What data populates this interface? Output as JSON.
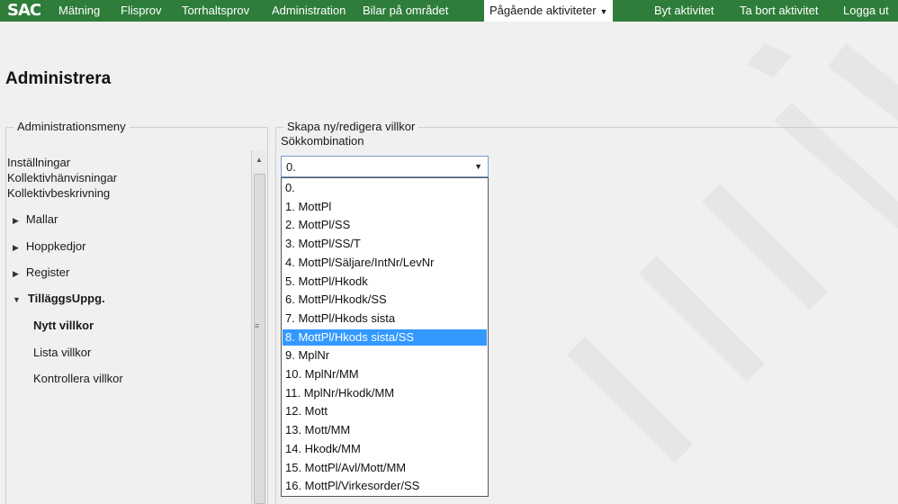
{
  "nav": {
    "logo": "SAC",
    "items": [
      "Mätning",
      "Flisprov",
      "Torrhaltsprov",
      "Administration",
      "Bilar på området"
    ],
    "active": "Pågående aktiviteter",
    "right_items": [
      "Byt aktivitet",
      "Ta bort aktivitet",
      "Logga ut"
    ]
  },
  "page": {
    "title": "Administrera"
  },
  "menu": {
    "legend": "Administrationsmeny",
    "plain_items": [
      "Inställningar",
      "Kollektivhänvisningar",
      "Kollektivbeskrivning"
    ],
    "collapsed_groups": [
      "Mallar",
      "Hoppkedjor",
      "Register"
    ],
    "expanded_group": "TilläggsUppg.",
    "sub_items": [
      "Nytt villkor",
      "Lista villkor",
      "Kontrollera villkor"
    ],
    "active_sub_item": "Nytt villkor"
  },
  "form": {
    "legend": "Skapa ny/redigera villkor",
    "field_label": "Sökkombination",
    "selected_value": "0.",
    "options": [
      "0.",
      "1. MottPl",
      "2. MottPl/SS",
      "3. MottPl/SS/T",
      "4. MottPl/Säljare/IntNr/LevNr",
      "5. MottPl/Hkodk",
      "6. MottPl/Hkodk/SS",
      "7. MottPl/Hkods sista",
      "8. MottPl/Hkods sista/SS",
      "9. MplNr",
      "10. MplNr/MM",
      "11. MplNr/Hkodk/MM",
      "12. Mott",
      "13. Mott/MM",
      "14. Hkodk/MM",
      "15. MottPl/Avl/Mott/MM",
      "16. MottPl/Virkesorder/SS"
    ],
    "highlighted_option": "8. MottPl/Hkods sista/SS"
  },
  "colors": {
    "nav_bg": "#2e7d3a",
    "highlight": "#3399ff"
  }
}
